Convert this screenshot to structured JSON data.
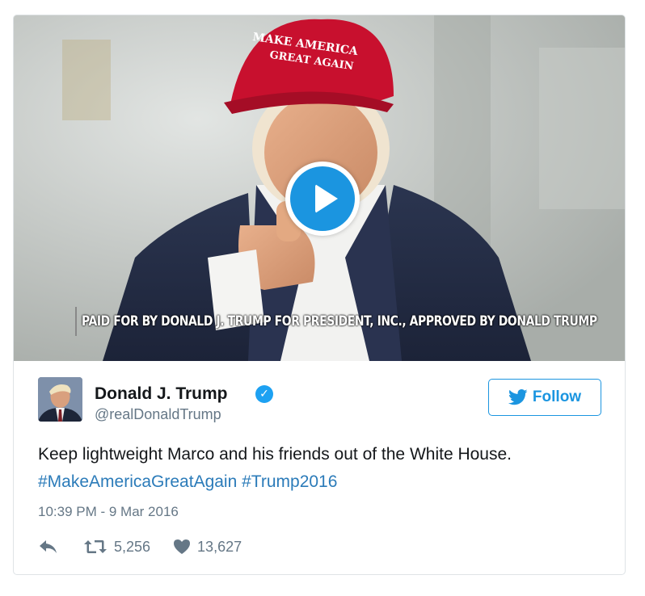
{
  "media": {
    "hat_text_line1": "MAKE AMERICA",
    "hat_text_line2": "GREAT AGAIN",
    "disclaimer": "PAID FOR BY DONALD J. TRUMP FOR PRESIDENT, INC., APPROVED BY DONALD TRUMP"
  },
  "user": {
    "name": "Donald J. Trump",
    "handle": "@realDonaldTrump",
    "verified_icon": "verified-check-icon"
  },
  "follow_label": "Follow",
  "tweet": {
    "text": "Keep lightweight Marco and his friends out of the White House.",
    "hashtag1": "#MakeAmericaGreatAgain",
    "hashtag2": "#Trump2016",
    "timestamp": "10:39 PM - 9 Mar 2016"
  },
  "actions": {
    "retweets": "5,256",
    "likes": "13,627"
  },
  "colors": {
    "accent": "#1b95e0",
    "hashtag": "#2b7bb9",
    "muted": "#657786"
  }
}
